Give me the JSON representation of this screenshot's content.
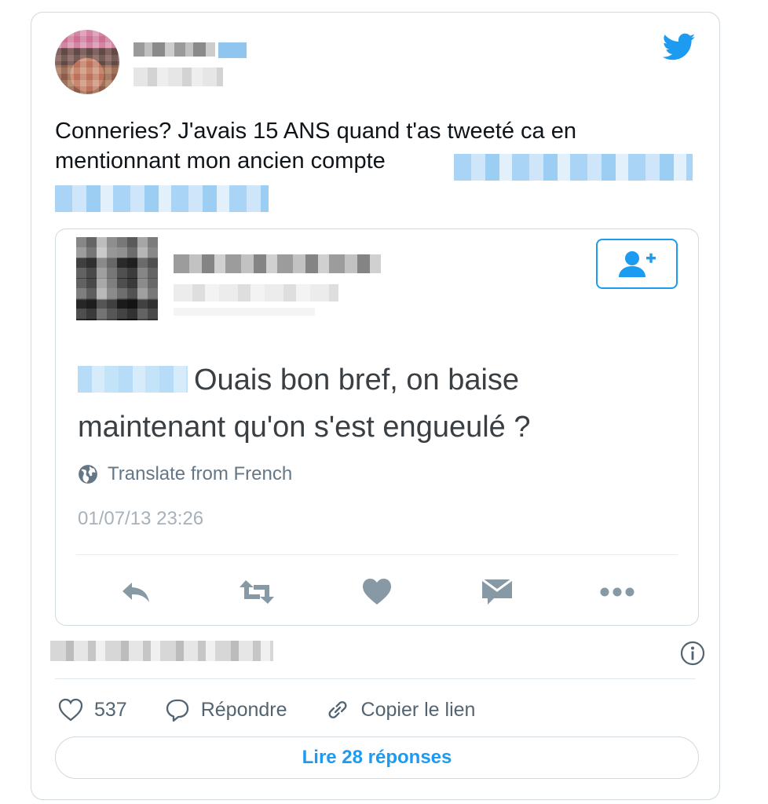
{
  "tweet": {
    "text_line1": "Conneries? J'avais 15 ANS quand t'as tweeté ca en",
    "text_line2": "mentionnant mon ancien compte",
    "brand_color": "#1d9bf0"
  },
  "quoted_tweet": {
    "text_line1": "Ouais bon bref, on baise",
    "text_line2": "maintenant qu'on s'est engueulé ?",
    "translate_label": "Translate from French",
    "timestamp": "01/07/13 23:26",
    "follow_icon": "add-user-icon",
    "actions": [
      "reply-icon",
      "retweet-icon",
      "like-icon",
      "message-icon",
      "more-icon"
    ]
  },
  "footer": {
    "likes_count": "537",
    "reply_label": "Répondre",
    "copy_link_label": "Copier le lien",
    "read_replies_label": "Lire 28 réponses"
  }
}
